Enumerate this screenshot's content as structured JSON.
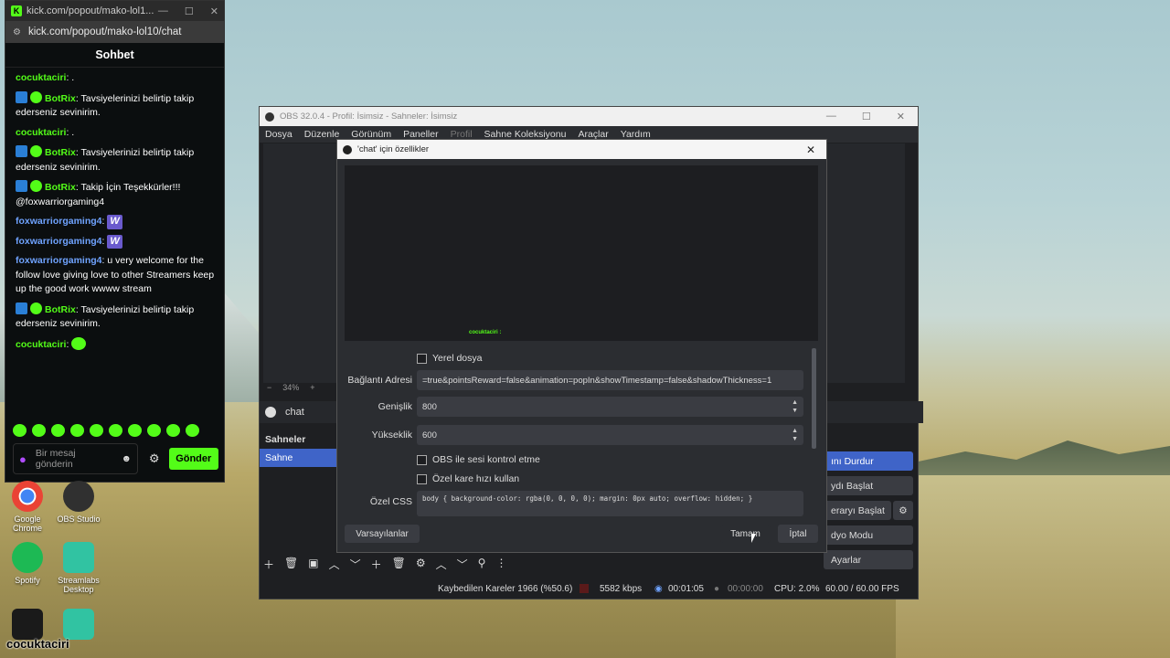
{
  "kick": {
    "tab_title": "kick.com/popout/mako-lol1...",
    "url": "kick.com/popout/mako-lol10/chat",
    "header": "Sohbet",
    "messages": [
      {
        "user": "cocuktaciri",
        "text": ": ."
      },
      {
        "user": "BotRix",
        "text": ": Tavsiyelerinizi belirtip takip ederseniz sevinirim."
      },
      {
        "user": "cocuktaciri",
        "text": ": ."
      },
      {
        "user": "BotRix",
        "text": ": Tavsiyelerinizi belirtip takip ederseniz sevinirim."
      },
      {
        "user": "BotRix",
        "text": ": Takip İçin Teşekkürler!!! @foxwarriorgaming4"
      },
      {
        "user": "foxwarriorgaming4",
        "text": ":",
        "emote": "W"
      },
      {
        "user": "foxwarriorgaming4",
        "text": ":",
        "emote": "W"
      },
      {
        "user": "foxwarriorgaming4",
        "text": ": u very welcome for the follow love giving love to other Streamers keep up the good work wwww stream"
      },
      {
        "user": "BotRix",
        "text": ": Tavsiyelerinizi belirtip takip ederseniz sevinirim."
      },
      {
        "user": "cocuktaciri",
        "text": ":"
      }
    ],
    "input_placeholder": "Bir mesaj gönderin",
    "send_label": "Gönder"
  },
  "desktop": {
    "icons": [
      {
        "label": "Google Chrome",
        "color": "#e0e0e0"
      },
      {
        "label": "OBS Studio",
        "color": "#303030"
      },
      {
        "label": "Spotify",
        "color": "#1db954"
      },
      {
        "label": "Streamlabs Desktop",
        "color": "#31c3a2"
      }
    ],
    "streamer_tag": "cocuktaciri"
  },
  "obs": {
    "title": "OBS 32.0.4 - Profil: İsimsiz - Sahneler: İsimsiz",
    "menu": [
      "Dosya",
      "Düzenle",
      "Görünüm",
      "Paneller",
      "Profil",
      "Sahne Koleksiyonu",
      "Araçlar",
      "Yardım"
    ],
    "zoom": "34%",
    "selected_source": "chat",
    "scenes_header": "Sahneler",
    "scene_item": "Sahne",
    "controls": {
      "stop": "ını Durdur",
      "record": "ydı Başlat",
      "virtual": "eraryı Başlat",
      "studio": "dyo Modu",
      "settings": "Ayarlar"
    },
    "status": {
      "dropped": "Kaybedilen Kareler 1966 (%50.6)",
      "kbps": "5582 kbps",
      "stream_time": "00:01:05",
      "rec_time": "00:00:00",
      "cpu": "CPU: 2.0%",
      "fps": "60.00 / 60.00 FPS"
    }
  },
  "dialog": {
    "title": "'chat' için özellikler",
    "preview_text": "cocuktaciri :",
    "local_file": "Yerel dosya",
    "url_label": "Bağlantı Adresi",
    "url_value": "=true&pointsReward=false&animation=popIn&showTimestamp=false&shadowThickness=1",
    "width_label": "Genişlik",
    "width_value": "800",
    "height_label": "Yükseklik",
    "height_value": "600",
    "audio_check": "OBS ile sesi kontrol etme",
    "fps_check": "Özel kare hızı kullan",
    "css_label": "Özel CSS",
    "css_value": "body { background-color: rgba(0, 0, 0, 0); margin: 0px auto; overflow: hidden; }",
    "defaults_btn": "Varsayılanlar",
    "ok_btn": "Tamam",
    "cancel_btn": "İptal"
  },
  "colors": {
    "kick_green": "#53fc18",
    "obs_blue": "#3f64c8"
  }
}
